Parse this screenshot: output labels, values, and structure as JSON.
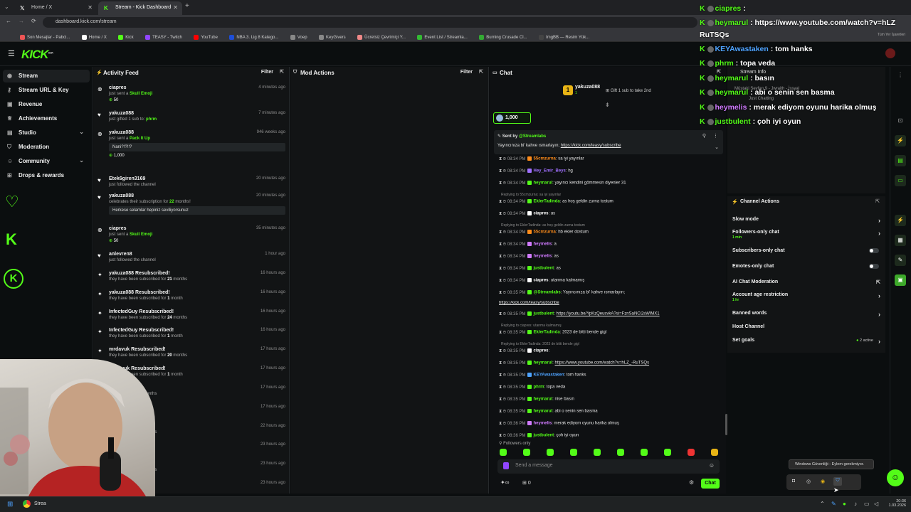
{
  "browser": {
    "tabs": [
      {
        "label": "Home / X",
        "icon": "x-icon"
      },
      {
        "label": "Stream - Kick Dashboard",
        "icon": "kick-icon"
      }
    ],
    "url": "dashboard.kick.com/stream",
    "bookmarks": [
      "Son Mesajlar - Pabci...",
      "Home / X",
      "Kick",
      "TEASY - Twitch",
      "YouTube",
      "NBA 3. Lig 8 Katego...",
      "Voep",
      "KeyGivers",
      "Ücretsiz Çevrimiçi Y...",
      "Event List / Streamla...",
      "Burning Crusade Cl...",
      "ImgBB — Resim Yük..."
    ],
    "bookmarks_right": "Tüm Yer İşaretleri"
  },
  "app": {
    "logo": "KICK",
    "beta": "BETA"
  },
  "sidebar": {
    "items": [
      {
        "label": "Stream",
        "icon": "stream-icon"
      },
      {
        "label": "Stream URL & Key",
        "icon": "key-icon"
      },
      {
        "label": "Revenue",
        "icon": "revenue-icon"
      },
      {
        "label": "Achievements",
        "icon": "trophy-icon"
      },
      {
        "label": "Studio",
        "icon": "studio-icon"
      },
      {
        "label": "Moderation",
        "icon": "shield-icon"
      },
      {
        "label": "Community",
        "icon": "community-icon"
      },
      {
        "label": "Drops & rewards",
        "icon": "gift-icon"
      }
    ]
  },
  "activity": {
    "title": "Activity Feed",
    "filter": "Filter",
    "items": [
      {
        "name": "ciapres",
        "line1": "just sent a ",
        "hl": "Skull Emoji",
        "extra": "50",
        "time": "4 minutes ago"
      },
      {
        "name": "yakuza088",
        "line1": "just gifted 1 sub to: ",
        "hl": "phrm",
        "time": "7 minutes ago"
      },
      {
        "name": "yakuza088",
        "line1": "just sent a ",
        "hl": "Pack It Up",
        "quote": "Nani?!?!!?",
        "extra": "1,000",
        "time": "946 weeks ago"
      },
      {
        "name": "Etek6giren3169",
        "line1": "just followed the channel",
        "time": "20 minutes ago"
      },
      {
        "name": "yakuza088",
        "line1": "celebrates their subscription for ",
        "hl": "22",
        "line1b": " months!",
        "quote": "Herkese selamlar hepiniz seviliyorsunuz",
        "time": "20 minutes ago"
      },
      {
        "name": "ciapres",
        "line1": "just sent a ",
        "hl": "Skull Emoji",
        "extra": "50",
        "time": "35 minutes ago"
      },
      {
        "name": "anlevren8",
        "line1": "just followed the channel",
        "time": "1 hour ago"
      },
      {
        "name": "yakuza088 Resubscribed!",
        "line1": "they have been subscribed for ",
        "bold": "21",
        "line1b": " months",
        "time": "16 hours ago"
      },
      {
        "name": "yakuza088 Resubscribed!",
        "line1": "they have been subscribed for ",
        "bold": "1",
        "line1b": " month",
        "time": "16 hours ago"
      },
      {
        "name": "InfectedGuy Resubscribed!",
        "line1": "they have been subscribed for ",
        "bold": "24",
        "line1b": " months",
        "time": "16 hours ago"
      },
      {
        "name": "InfectedGuy Resubscribed!",
        "line1": "they have been subscribed for ",
        "bold": "1",
        "line1b": " month",
        "time": "16 hours ago"
      },
      {
        "name": "mrdavuk Resubscribed!",
        "line1": "they have been subscribed for ",
        "bold": "20",
        "line1b": " months",
        "time": "17 hours ago"
      },
      {
        "name": "mrdavuk Resubscribed!",
        "line1": "they have been subscribed for ",
        "bold": "1",
        "line1b": " month",
        "time": "17 hours ago"
      },
      {
        "name": "ubscribed!",
        "line1": "subscribed for ",
        "bold": "25",
        "line1b": " months",
        "time": "17 hours ago"
      },
      {
        "name": "ubscribed!",
        "line1": "subscribed for ",
        "bold": "1",
        "line1b": " month",
        "time": "17 hours ago"
      },
      {
        "name": "ubscribed!",
        "line1": "subscribed for ",
        "bold": "20",
        "line1b": " months",
        "time": "22 hours ago"
      },
      {
        "name": "",
        "line1": "",
        "time": "23 hours ago"
      },
      {
        "name": "ubscribed!",
        "line1": "subscribed for ",
        "bold": "19",
        "line1b": " months",
        "time": "23 hours ago"
      },
      {
        "name": "goal",
        "line1": "",
        "time": "23 hours ago"
      }
    ]
  },
  "mod": {
    "title": "Mod Actions",
    "filter": "Filter"
  },
  "chat": {
    "title": "Chat",
    "top_gifter": "yakuza088",
    "top_gifter_count": "1",
    "gift_label": "Gift 1 sub to take 2nd",
    "goal_value": "1,000",
    "pinned_by": "Sent by",
    "pinned_user": "@Streamlabs",
    "pinned_text": "Yayıncınıza bi' kahve ısmarlayın; ",
    "pinned_link": "https://kick.com/teasy/subscribe",
    "messages": [
      {
        "time": "08:34 PM",
        "user": "55cmzurna",
        "color": "#ff8c1a",
        "text": "sa iyi yayınlar"
      },
      {
        "time": "08:34 PM",
        "user": "Hey_Emir_Beys",
        "color": "#a070ff",
        "text": "hg"
      },
      {
        "time": "08:34 PM",
        "user": "heymarul",
        "color": "#53fc18",
        "text": "yayıncı kendini gömmesin diyenler 31"
      },
      {
        "reply": "Replying to 55cmzurna: sa iyi yayınlar"
      },
      {
        "time": "08:34 PM",
        "user": "EklerTadinda",
        "color": "#53fc18",
        "text": "as hoş geldin zurna tostum"
      },
      {
        "time": "08:34 PM",
        "user": "ciapres",
        "color": "#ffffff",
        "text": "as"
      },
      {
        "reply": "Replying to EklerTadinda: as hoş geldin zurna tostum"
      },
      {
        "time": "08:34 PM",
        "user": "55cmzurna",
        "color": "#ff8c1a",
        "text": "hb ekler dostum"
      },
      {
        "time": "08:34 PM",
        "user": "heymelis",
        "color": "#d07aff",
        "text": "a"
      },
      {
        "time": "08:34 PM",
        "user": "heymelis",
        "color": "#d07aff",
        "text": "as"
      },
      {
        "time": "08:34 PM",
        "user": "justbulent",
        "color": "#53fc18",
        "text": "as"
      },
      {
        "time": "08:34 PM",
        "user": "ciapres",
        "color": "#ffffff",
        "text": "utanma kalmamış"
      },
      {
        "time": "08:35 PM",
        "user": "@Streamlabs",
        "color": "#53fc18",
        "text": "Yayıncınıza bi' kahve ısmarlayın;"
      },
      {
        "cont": "https://kick.com/teasy/subscribe"
      },
      {
        "time": "08:35 PM",
        "user": "justbulent",
        "color": "#53fc18",
        "text": "https://youtu.be/YpKzQeusvkA?si=FznSaNCi2sWlMX1"
      },
      {
        "reply": "Replying to ciapres: utanma kalmamış"
      },
      {
        "time": "08:35 PM",
        "user": "EklerTadinda",
        "color": "#53fc18",
        "text": "2023 de bitti bende gigl"
      },
      {
        "reply": "Replying to EklerTadinda: 2023 de bitti bende gigl"
      },
      {
        "time": "08:35 PM",
        "user": "ciapres",
        "color": "#ffffff",
        "text": ""
      },
      {
        "time": "08:35 PM",
        "user": "heymarul",
        "color": "#53fc18",
        "text": "https://www.youtube.com/watch?v=hLZ_-RuTSQs"
      },
      {
        "time": "08:35 PM",
        "user": "KEYAwastaken",
        "color": "#4ea3ff",
        "text": "tom hanks"
      },
      {
        "time": "08:35 PM",
        "user": "phrm",
        "color": "#53fc18",
        "text": "topa veda"
      },
      {
        "time": "08:35 PM",
        "user": "heymarul",
        "color": "#53fc18",
        "text": "nise basın"
      },
      {
        "time": "08:35 PM",
        "user": "heymarul",
        "color": "#53fc18",
        "text": "abi o senin sen basma"
      },
      {
        "time": "08:36 PM",
        "user": "heymelis",
        "color": "#d07aff",
        "text": "merak ediyom oyunu harika olmuş"
      },
      {
        "time": "08:36 PM",
        "user": "justbulent",
        "color": "#53fc18",
        "text": "çoh iyi oyun"
      }
    ],
    "mode": "Followers only",
    "placeholder": "Send a message",
    "count": "0",
    "send": "Chat"
  },
  "stream_info": {
    "title": "Stream Info",
    "line1": "Müştaki Seyfan 9 - Jwraith - İssyal",
    "line2": "Just Chatting",
    "line3": "LU ... 125 ..."
  },
  "actions": {
    "title": "Channel Actions",
    "items": [
      {
        "label": "Slow mode",
        "kind": "chev"
      },
      {
        "label": "Followers-only chat",
        "sub": "1 min",
        "kind": "chev"
      },
      {
        "label": "Subscribers-only chat",
        "kind": "toggle"
      },
      {
        "label": "Emotes-only chat",
        "kind": "toggle"
      },
      {
        "label": "AI Chat Moderation",
        "kind": "ext"
      },
      {
        "label": "Account age restriction",
        "sub": "1 hr",
        "kind": "chev"
      },
      {
        "label": "Banned words",
        "kind": "chev"
      },
      {
        "label": "Host Channel",
        "kind": "none"
      },
      {
        "label": "Set goals",
        "kind": "active",
        "extra": "2 active"
      }
    ]
  },
  "overlay": [
    {
      "user": "ciapres",
      "color": "#53fc18",
      "text": ":"
    },
    {
      "user": "heymarul",
      "color": "#53fc18",
      "text": ": https://www.youtube.com/watch?v=hLZ"
    },
    {
      "user": "",
      "color": "#ffffff",
      "text": "RuTSQs"
    },
    {
      "user": "KEYAwastaken",
      "color": "#4ea3ff",
      "text": ": tom hanks"
    },
    {
      "user": "phrm",
      "color": "#53fc18",
      "text": ": topa veda"
    },
    {
      "user": "heymarul",
      "color": "#53fc18",
      "text": ": basın"
    },
    {
      "user": "heymarul",
      "color": "#53fc18",
      "text": ": abi o senin sen basma"
    },
    {
      "user": "heymelis",
      "color": "#d07aff",
      "text": ": merak ediyom oyunu harika olmuş"
    },
    {
      "user": "justbulent",
      "color": "#53fc18",
      "text": ": çoh iyi oyun"
    }
  ],
  "tooltip": "Windows Güvenliği - Eylem gerekmiyor.",
  "taskbar": {
    "app_label": "Strea",
    "time": "20:36",
    "date": "1.03.2026"
  },
  "colors": {
    "accent": "#53fc18",
    "bg": "#0b0e0f",
    "panel": "#121415"
  }
}
